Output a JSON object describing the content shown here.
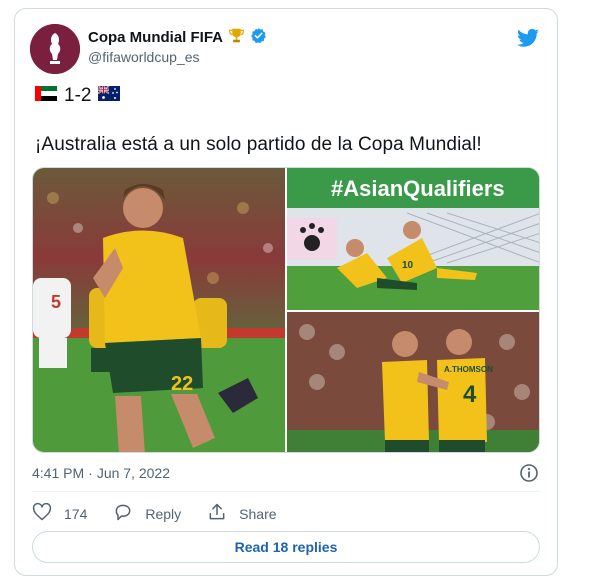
{
  "tweet": {
    "author_name": "Copa Mundial FIFA",
    "author_handle": "@fifaworldcup_es",
    "score_text": "1-2",
    "text": "¡Australia está a un solo partido de la Copa Mundial!",
    "time": "4:41 PM",
    "separator": "·",
    "date": "Jun 7, 2022",
    "likes": "174",
    "reply_label": "Reply",
    "share_label": "Share",
    "read_replies_label": "Read 18 replies"
  },
  "media": {
    "banner_text": "#AsianQualifiers",
    "player_number_main": "22",
    "opponent_number": "5",
    "player_name_shirt": "A.THOMSON",
    "player_number_right": "4",
    "player_number_top": "10"
  },
  "icons": {
    "verified": "verified-badge-icon",
    "trophy": "trophy-icon",
    "bird": "twitter-bird-icon",
    "like": "heart-icon",
    "reply": "reply-bubble-icon",
    "share": "share-icon",
    "info": "info-icon",
    "flag_left": "uae-flag-icon",
    "flag_right": "australia-flag-icon"
  },
  "colors": {
    "accent": "#1d9bf0",
    "link": "#1d63b0",
    "muted": "#536471",
    "border": "#cfd9de",
    "aus_gold": "#f2c21b",
    "aus_green": "#1f4d2b"
  }
}
